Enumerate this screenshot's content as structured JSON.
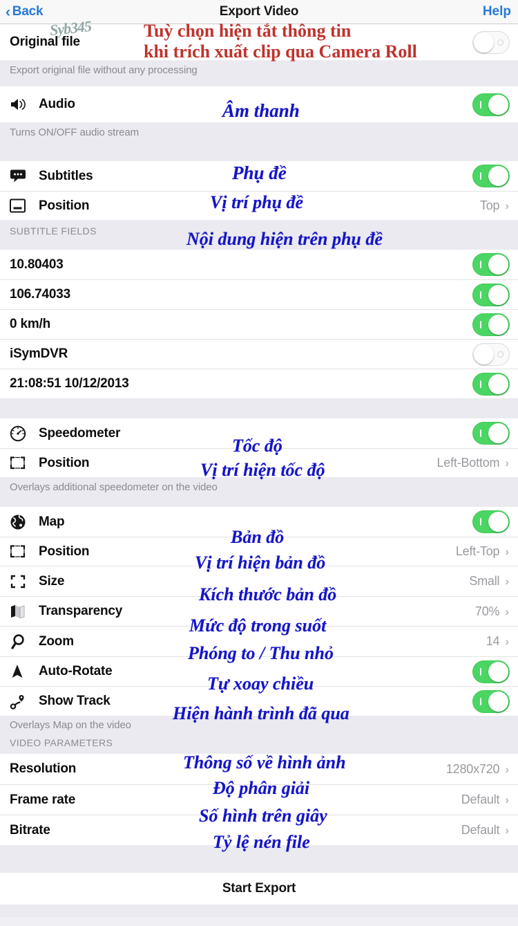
{
  "nav": {
    "back_label": "Back",
    "title": "Export Video",
    "help_label": "Help",
    "back_icon": "chevron-left-icon"
  },
  "watermark": {
    "signature": "Syb345"
  },
  "sections": {
    "original": {
      "row_label": "Original file",
      "toggle_state": "off",
      "footnote": "Export original file without any processing"
    },
    "audio": {
      "row_label": "Audio",
      "icon": "speaker-icon",
      "toggle_state": "on",
      "footnote": "Turns ON/OFF audio stream"
    },
    "subtitles": {
      "title_label": "Subtitles",
      "title_icon": "speech-bubble-icon",
      "title_toggle": "on",
      "position_label": "Position",
      "position_icon": "subtitle-position-icon",
      "position_value": "Top"
    },
    "subtitle_fields": {
      "header": "SUBTITLE FIELDS",
      "items": [
        {
          "label": "10.80403",
          "toggle": "on"
        },
        {
          "label": "106.74033",
          "toggle": "on"
        },
        {
          "label": "0 km/h",
          "toggle": "on"
        },
        {
          "label": "iSymDVR",
          "toggle": "off"
        },
        {
          "label": "21:08:51 10/12/2013",
          "toggle": "on"
        }
      ]
    },
    "speedometer": {
      "title_label": "Speedometer",
      "title_icon": "gauge-icon",
      "title_toggle": "on",
      "position_label": "Position",
      "position_icon": "frame-position-icon",
      "position_value": "Left-Bottom",
      "footnote": "Overlays additional speedometer on the video"
    },
    "map": {
      "title_label": "Map",
      "title_icon": "globe-icon",
      "title_toggle": "on",
      "rows": [
        {
          "label": "Position",
          "icon": "frame-position-icon",
          "kind": "value",
          "value": "Left-Top"
        },
        {
          "label": "Size",
          "icon": "size-corners-icon",
          "kind": "value",
          "value": "Small"
        },
        {
          "label": "Transparency",
          "icon": "map-fold-icon",
          "kind": "value",
          "value": "70%"
        },
        {
          "label": "Zoom",
          "icon": "magnifier-icon",
          "kind": "value",
          "value": "14"
        },
        {
          "label": "Auto-Rotate",
          "icon": "navigation-arrow-icon",
          "kind": "toggle",
          "toggle": "on"
        },
        {
          "label": "Show Track",
          "icon": "track-path-icon",
          "kind": "toggle",
          "toggle": "on"
        }
      ],
      "footnote": "Overlays Map on the video"
    },
    "video_parameters": {
      "header": "VIDEO PARAMETERS",
      "rows": [
        {
          "label": "Resolution",
          "value": "1280x720"
        },
        {
          "label": "Frame rate",
          "value": "Default"
        },
        {
          "label": "Bitrate",
          "value": "Default"
        }
      ]
    },
    "action": {
      "start_export_label": "Start Export"
    }
  },
  "annotations": {
    "red": [
      "Tuỳ chọn hiện tắt thông tin",
      "khi trích xuất clip qua Camera Roll"
    ],
    "blue": [
      "Âm thanh",
      "Phụ đề",
      "Vị trí phụ đề",
      "Nội dung hiện trên phụ đề",
      "Tốc độ",
      "Vị trí hiện tốc độ",
      "Bản đồ",
      "Vị trí hiện bản đồ",
      "Kích thước bản đồ",
      "Mức độ trong suốt",
      "Phóng to / Thu nhỏ",
      "Tự xoay chiều",
      "Hiện hành trình đã qua",
      "Thông số về hình ảnh",
      "Độ phân giải",
      "Số hình trên giây",
      "Tỷ lệ nén file"
    ]
  },
  "colors": {
    "accent_blue": "#2878d8",
    "switch_on_green": "#4bd663",
    "annotation_blue": "#1414c8",
    "annotation_red": "#c0322c",
    "group_bg": "#ffffff",
    "page_bg": "#eaeaf0"
  }
}
